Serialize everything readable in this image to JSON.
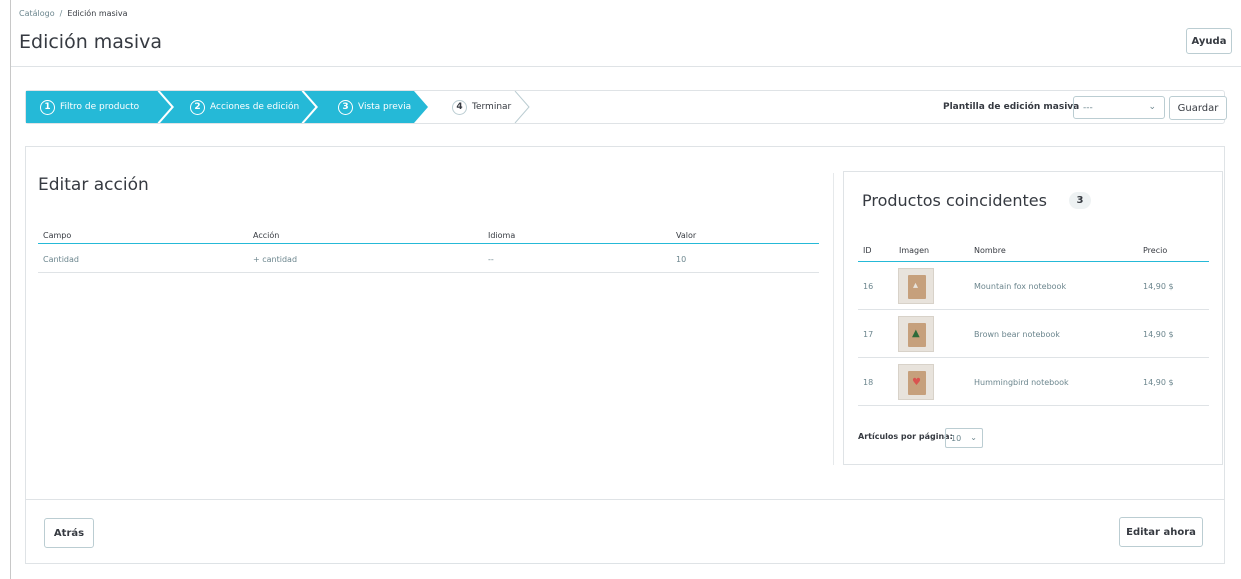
{
  "breadcrumb": {
    "parent": "Catálogo",
    "separator": "/",
    "current": "Edición masiva"
  },
  "page": {
    "title": "Edición masiva",
    "help_label": "Ayuda"
  },
  "wizard": {
    "steps": [
      {
        "number": "1",
        "label": "Filtro de producto",
        "state": "done"
      },
      {
        "number": "2",
        "label": "Acciones de edición",
        "state": "done"
      },
      {
        "number": "3",
        "label": "Vista previa",
        "state": "active"
      },
      {
        "number": "4",
        "label": "Terminar",
        "state": "pending"
      }
    ],
    "template_label": "Plantilla de edición masiva",
    "template_value": "---",
    "save_label": "Guardar",
    "accent_color": "#25b9d7"
  },
  "edit_action": {
    "title": "Editar acción",
    "headers": [
      "Campo",
      "Acción",
      "Idioma",
      "Valor"
    ],
    "rows": [
      {
        "campo": "Cantidad",
        "accion": "+ cantidad",
        "idioma": "--",
        "valor": "10"
      }
    ]
  },
  "matching_products": {
    "title": "Productos coincidentes",
    "count": "3",
    "headers": [
      "ID",
      "Imagen",
      "Nombre",
      "Precio"
    ],
    "rows": [
      {
        "id": "16",
        "image": "notebook-fox-image",
        "name": "Mountain fox notebook",
        "price": "14,90 $"
      },
      {
        "id": "17",
        "image": "notebook-bear-image",
        "name": "Brown bear notebook",
        "price": "14,90 $"
      },
      {
        "id": "18",
        "image": "notebook-hummingbird-image",
        "name": "Hummingbird notebook",
        "price": "14,90 $"
      }
    ],
    "per_page_label": "Artículos por página:",
    "per_page_value": "10"
  },
  "footer": {
    "back_label": "Atrás",
    "edit_now_label": "Editar ahora"
  }
}
